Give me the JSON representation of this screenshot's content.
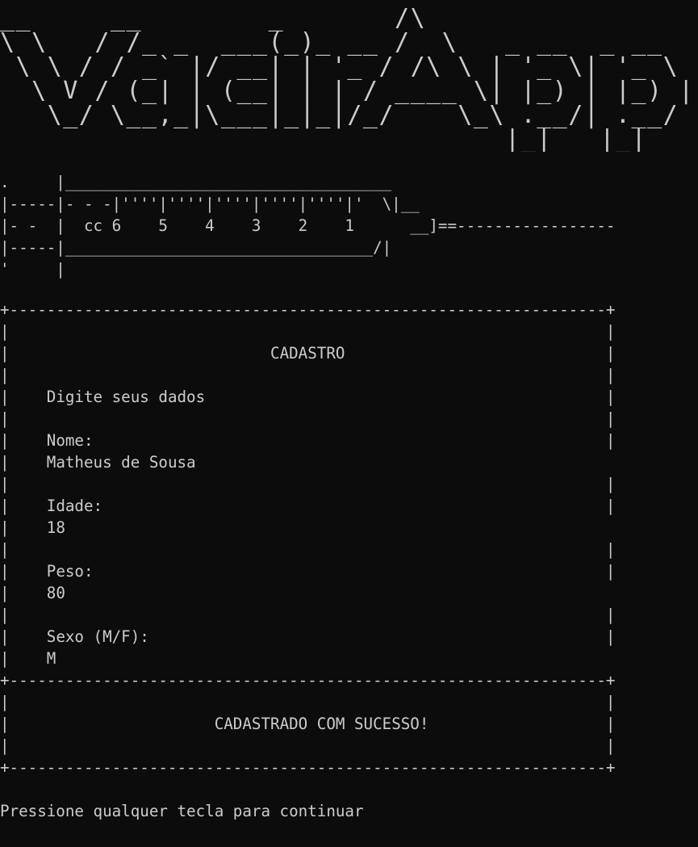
{
  "banner": {
    "logo_text": "VacinApp",
    "ascii_art": [
      "__     __        _       /\\",
      "\\ \\   / /_ _  ___(_)_ __ /  \\   _ __  _ __",
      " \\ \\ / / _` |/ __| | '_ / /\\ \\ | '_ \\| '_ \\",
      "  \\ V / (_| | (__| | | / ____ \\| |_) | |_) |",
      "   \\_/ \\__,_|\\___|_|_|/_/    \\_\\ .__/| .__/",
      "                                |_|   |_|"
    ]
  },
  "syringe": {
    "lines": [
      ".     |___________________________________",
      "|-----|- - -|''''|''''|''''|''''|''''|'  \\|__",
      "|- -  |  cc 6    5    4    3    2    1      __]==-----------------",
      "|-----|_________________________________/|",
      "'     |"
    ]
  },
  "form": {
    "border_top": "+----------------------------------------------------------------+",
    "title": "CADASTRO",
    "subtitle": "Digite seus dados",
    "fields": [
      {
        "label": "Nome:",
        "value": "Matheus de Sousa"
      },
      {
        "label": "Idade:",
        "value": "18"
      },
      {
        "label": "Peso:",
        "value": "80"
      },
      {
        "label": "Sexo (M/F):",
        "value": "M"
      }
    ],
    "border_mid": "+----------------------------------------------------------------+",
    "success_message": "CADASTRADO COM SUCESSO!",
    "border_bottom": "+----------------------------------------------------------------+"
  },
  "footer": {
    "prompt": "Pressione qualquer tecla para continuar"
  }
}
